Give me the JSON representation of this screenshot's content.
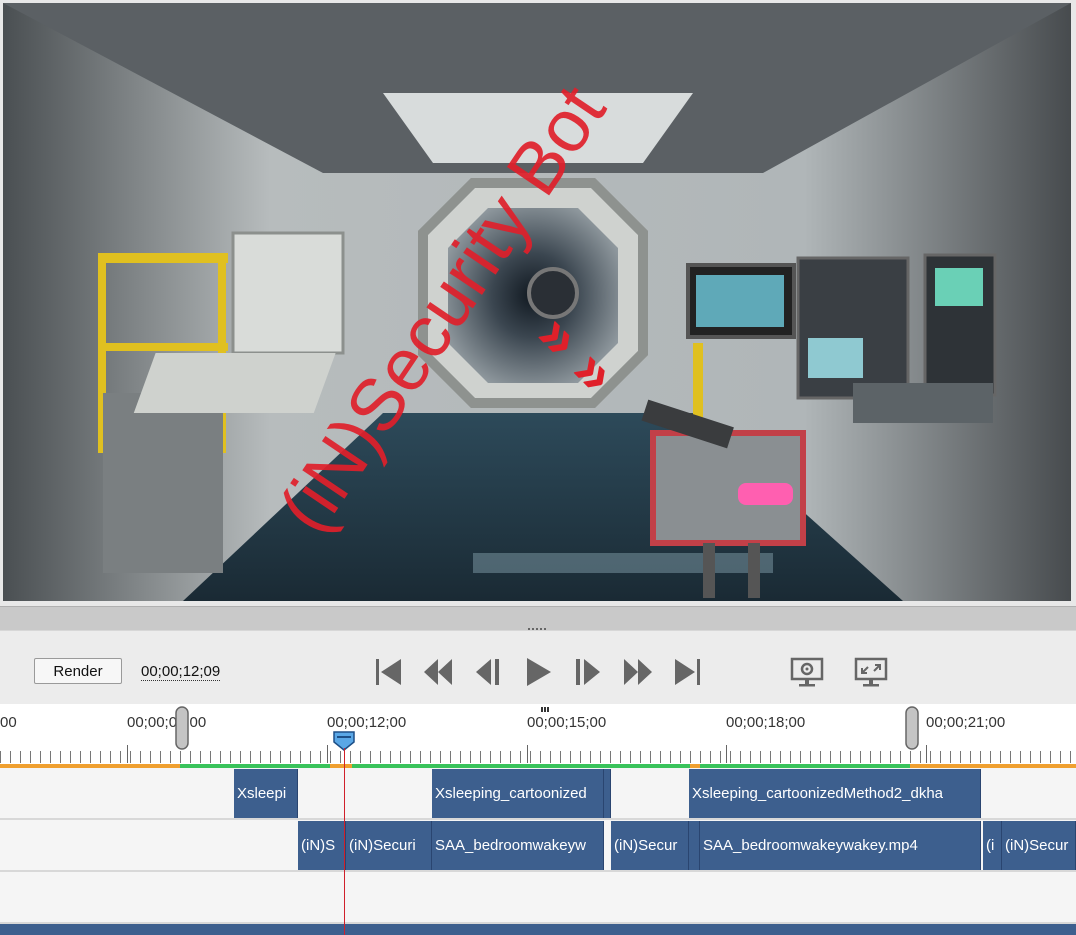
{
  "preview": {
    "overlay_text": "(iN)Security Bot",
    "chevrons": "» »"
  },
  "transport": {
    "render_label": "Render",
    "timecode": "00;00;12;09",
    "buttons": [
      "go-to-start",
      "previous-frame-fast",
      "previous-frame",
      "play",
      "next-frame",
      "next-frame-fast",
      "go-to-end",
      "preview-settings",
      "fit-to-screen"
    ]
  },
  "ruler": {
    "labels": [
      "00",
      "00;00;09;00",
      "00;00;12;00",
      "00;00;15;00",
      "00;00;18;00",
      "00;00;21;00"
    ],
    "playhead": "00;00;12;09"
  },
  "tracks": [
    {
      "clips": [
        {
          "label": "Xsleepi"
        },
        {
          "label": "Xsleeping_cartoonized"
        },
        {
          "label": ""
        },
        {
          "label": "Xsleeping_cartoonizedMethod2_dkha"
        }
      ]
    },
    {
      "clips": [
        {
          "label": "(iN)S"
        },
        {
          "label": "(iN)Securi"
        },
        {
          "label": "SAA_bedroomwakeyw"
        },
        {
          "label": "(iN)Secur"
        },
        {
          "label": ""
        },
        {
          "label": "SAA_bedroomwakeywakey.mp4"
        },
        {
          "label": "(i"
        },
        {
          "label": "(iN)Secur"
        }
      ]
    },
    {
      "clips": []
    }
  ],
  "colors": {
    "clip": "#3d5f8e",
    "playhead": "#d0202a",
    "overlay_red": "#e0202a",
    "range_green": "#39c35b",
    "range_orange": "#f0a030"
  }
}
